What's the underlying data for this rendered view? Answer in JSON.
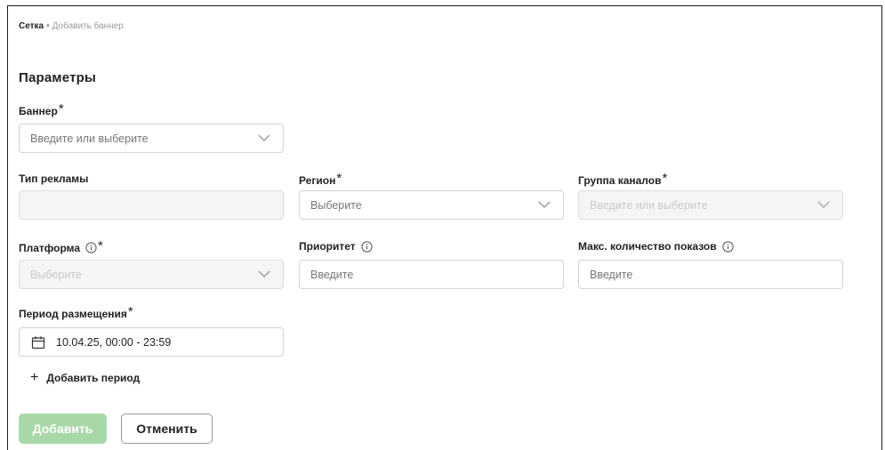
{
  "breadcrumb": {
    "root": "Сетка",
    "separator": "•",
    "current": "Добавить баннер"
  },
  "section_title": "Параметры",
  "required_mark": "*",
  "fields": {
    "banner": {
      "label": "Баннер",
      "placeholder": "Введите или выберите",
      "required": true
    },
    "ad_type": {
      "label": "Тип рекламы",
      "value": "",
      "disabled": true
    },
    "region": {
      "label": "Регион",
      "placeholder": "Выберите",
      "required": true
    },
    "channel_group": {
      "label": "Группа каналов",
      "placeholder": "Введите или выберите",
      "required": true,
      "disabled": true
    },
    "platform": {
      "label": "Платформа",
      "placeholder": "Выберите",
      "required": true,
      "disabled": true
    },
    "priority": {
      "label": "Приоритет",
      "placeholder": "Введите"
    },
    "max_impressions": {
      "label": "Макс. количество показов",
      "placeholder": "Введите"
    },
    "period": {
      "label": "Период размещения",
      "value": "10.04.25, 00:00 - 23:59",
      "required": true
    }
  },
  "add_period_label": "Добавить период",
  "buttons": {
    "submit": "Добавить",
    "cancel": "Отменить"
  },
  "colors": {
    "primary_disabled": "#a8d8a8",
    "border": "#d2d2d2",
    "disabled_bg": "#f5f5f5"
  }
}
